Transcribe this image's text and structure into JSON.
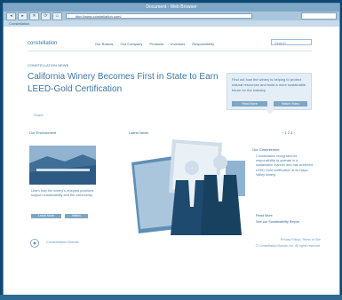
{
  "window": {
    "title": "Document - Web Browser"
  },
  "toolbar": {
    "back_label": "◂",
    "forward_label": "▸",
    "stop_label": "✕",
    "reload_label": "⟳",
    "home_label": "⌂",
    "url": "http://www.constellation.com/",
    "tab_label": "Constellation"
  },
  "site": {
    "logo_text": "constellation",
    "nav": [
      "Our Brands",
      "Our Company",
      "Products",
      "Investors",
      "Responsibility"
    ],
    "search_placeholder": "Search"
  },
  "article": {
    "kicker": "CONSTELLATION NEWS",
    "headline": "California Winery Becomes First in State to Earn LEED-Gold Certification",
    "share": "Share"
  },
  "promo": {
    "text": "Find out how the winery is helping to protect natural resources and build a more sustainable future for the industry.",
    "button1": "Read More",
    "button2": "Watch Video"
  },
  "sections": {
    "left_title": "Our Environment",
    "mid_title": "Latest News",
    "right_title": "Our Commitment"
  },
  "left_caption": "Learn how the winery's vineyard practices support sustainability and the community.",
  "left_buttons": [
    "Learn More",
    "Watch"
  ],
  "right": {
    "text": "Constellation recognizes its responsibility to operate in a sustainable manner and has achieved LEED Gold certification at its Napa Valley winery.",
    "link1": "Read More",
    "link2": "See our Sustainability Report"
  },
  "pager": "‹  1  2  3  ›",
  "footer": {
    "text": "Constellation Brands",
    "right1": "Privacy Policy | Terms of Use",
    "right2": "© Constellation Brands, Inc. All rights reserved."
  }
}
